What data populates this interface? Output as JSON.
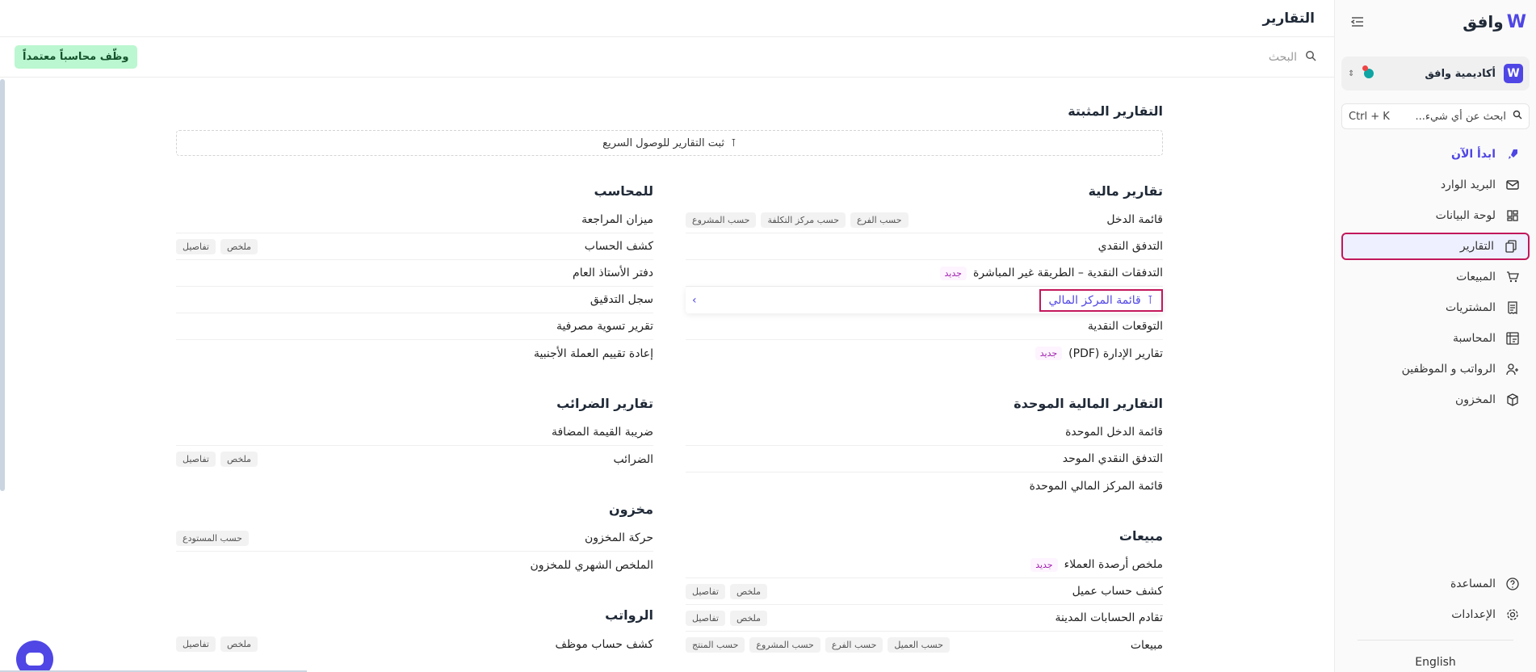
{
  "sidebar": {
    "logo_text": "وافق",
    "logo_mark": "W",
    "org_name": "أكاديمية وافق",
    "org_logo": "W",
    "search_placeholder": "ابحث عن أي شيء...",
    "search_shortcut": "Ctrl + K",
    "items": [
      {
        "label": "ابدأ الآن",
        "icon": "rocket-icon"
      },
      {
        "label": "البريد الوارد",
        "icon": "mail-icon"
      },
      {
        "label": "لوحة البيانات",
        "icon": "dashboard-icon"
      },
      {
        "label": "التقارير",
        "icon": "reports-icon"
      },
      {
        "label": "المبيعات",
        "icon": "cart-icon"
      },
      {
        "label": "المشتريات",
        "icon": "receipt-icon"
      },
      {
        "label": "المحاسبة",
        "icon": "ledger-icon"
      },
      {
        "label": "الرواتب و الموظفين",
        "icon": "users-icon"
      },
      {
        "label": "المخزون",
        "icon": "box-icon"
      }
    ],
    "help_label": "المساعدة",
    "settings_label": "الإعدادات",
    "language": "English"
  },
  "header": {
    "title": "التقارير",
    "search_placeholder": "البحث",
    "cta": "وظّف محاسباً معتمداً"
  },
  "pinned": {
    "title": "التقارير المثبتة",
    "hint": "ثبت التقارير للوصول السريع"
  },
  "right_col": {
    "financial": {
      "title": "تقارير مالية",
      "rows": [
        {
          "label": "قائمة الدخل",
          "badges": [
            "حسب الفرع",
            "حسب مركز التكلفة",
            "حسب المشروع"
          ]
        },
        {
          "label": "التدفق النقدي"
        },
        {
          "label": "التدفقات النقدية – الطريقة غير المباشرة",
          "new": "جديد"
        },
        {
          "label": "قائمة المركز المالي"
        },
        {
          "label": "التوقعات النقدية"
        },
        {
          "label": "تقارير الإدارة (PDF)",
          "new": "جديد"
        }
      ]
    },
    "consolidated": {
      "title": "التقارير المالية الموحدة",
      "rows": [
        {
          "label": "قائمة الدخل الموحدة"
        },
        {
          "label": "التدفق النقدي الموحد"
        },
        {
          "label": "قائمة المركز المالي الموحدة"
        }
      ]
    },
    "sales": {
      "title": "مبيعات",
      "rows": [
        {
          "label": "ملخص أرصدة العملاء",
          "new": "جديد"
        },
        {
          "label": "كشف حساب عميل",
          "badges": [
            "ملخص",
            "تفاصيل"
          ]
        },
        {
          "label": "تقادم الحسابات المدينة",
          "badges": [
            "ملخص",
            "تفاصيل"
          ]
        },
        {
          "label": "مبيعات",
          "badges": [
            "حسب العميل",
            "حسب الفرع",
            "حسب المشروع",
            "حسب المنتج"
          ]
        }
      ]
    }
  },
  "left_col": {
    "accountant": {
      "title": "للمحاسب",
      "rows": [
        {
          "label": "ميزان المراجعة"
        },
        {
          "label": "كشف الحساب",
          "badges": [
            "ملخص",
            "تفاصيل"
          ]
        },
        {
          "label": "دفتر الأستاذ العام"
        },
        {
          "label": "سجل التدقيق"
        },
        {
          "label": "تقرير تسوية مصرفية"
        },
        {
          "label": "إعادة تقييم العملة الأجنبية"
        }
      ]
    },
    "taxes": {
      "title": "تقارير الضرائب",
      "rows": [
        {
          "label": "ضريبة القيمة المضافة"
        },
        {
          "label": "الضرائب",
          "badges": [
            "ملخص",
            "تفاصيل"
          ]
        }
      ]
    },
    "inventory": {
      "title": "مخزون",
      "rows": [
        {
          "label": "حركة المخزون",
          "badges": [
            "حسب المستودع"
          ]
        },
        {
          "label": "الملخص الشهري للمخزون"
        }
      ]
    },
    "payroll": {
      "title": "الرواتب",
      "rows": [
        {
          "label": "كشف حساب موظف",
          "badges": [
            "ملخص",
            "تفاصيل"
          ]
        }
      ]
    }
  },
  "colors": {
    "accent": "#4f46e5",
    "highlight": "#c2185b",
    "cta_bg": "#bbf7d0"
  }
}
